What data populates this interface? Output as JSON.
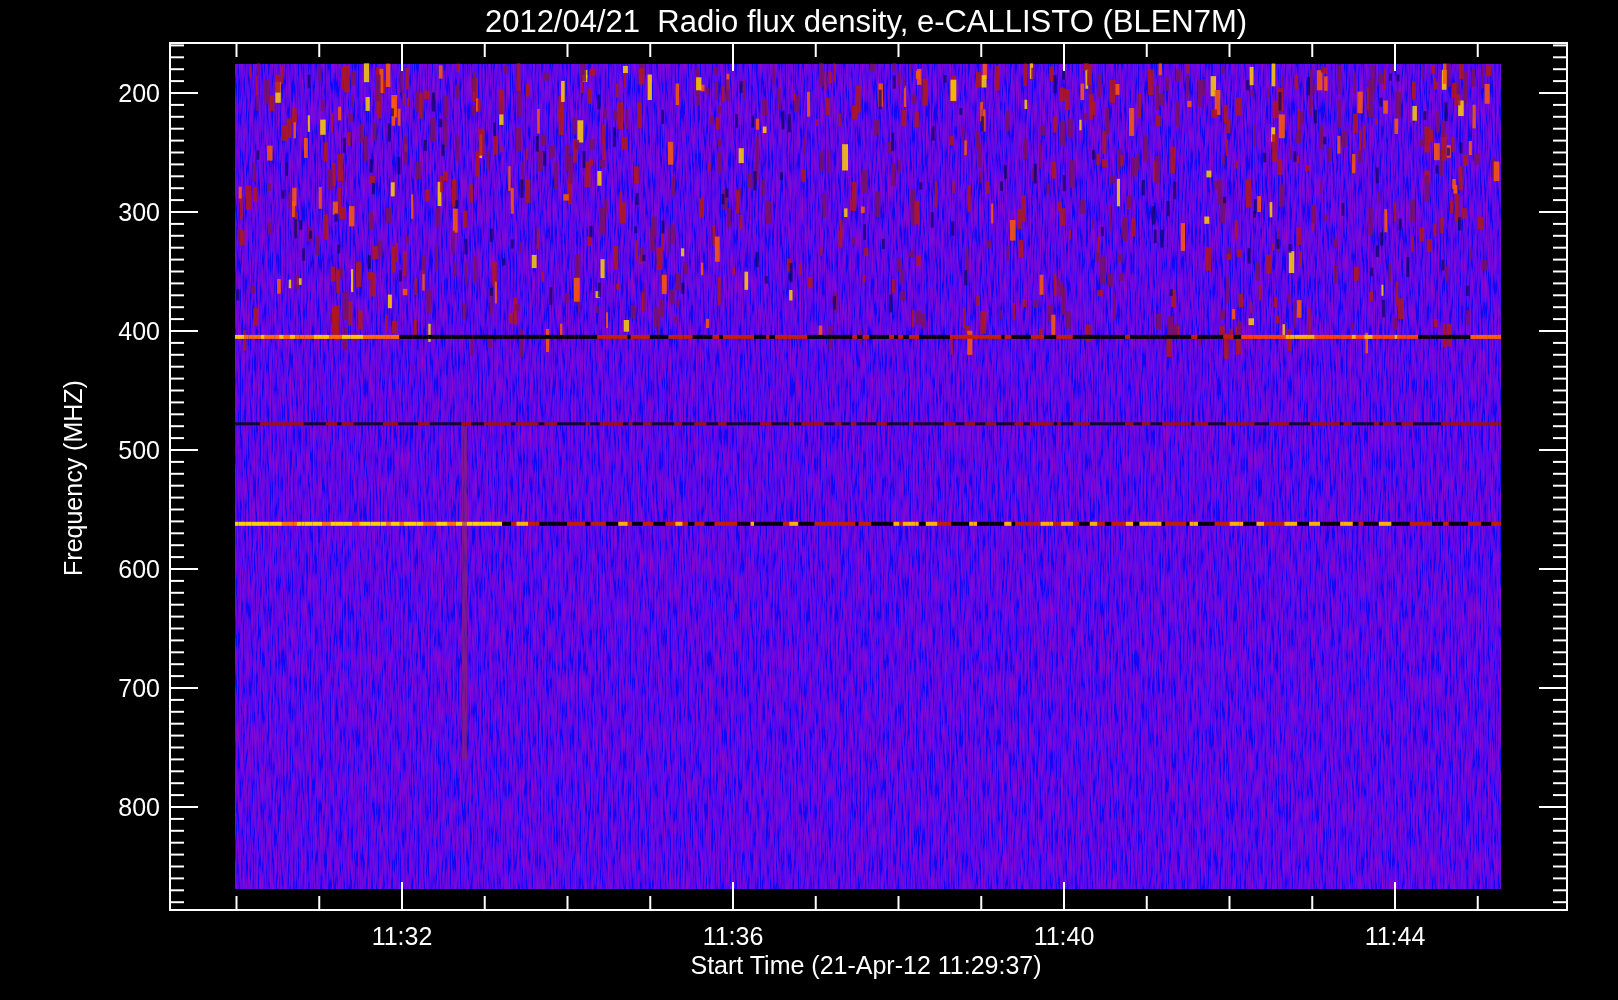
{
  "title": "2012/04/21  Radio flux density, e-CALLISTO (BLEN7M)",
  "y_axis": {
    "label": "Frequency (MHZ)",
    "ticks": [
      "200",
      "300",
      "400",
      "500",
      "600",
      "700",
      "800"
    ]
  },
  "x_axis": {
    "label": "Start Time (21-Apr-12 11:29:37)",
    "ticks": [
      "11:32",
      "11:36",
      "11:40",
      "11:44"
    ]
  }
}
